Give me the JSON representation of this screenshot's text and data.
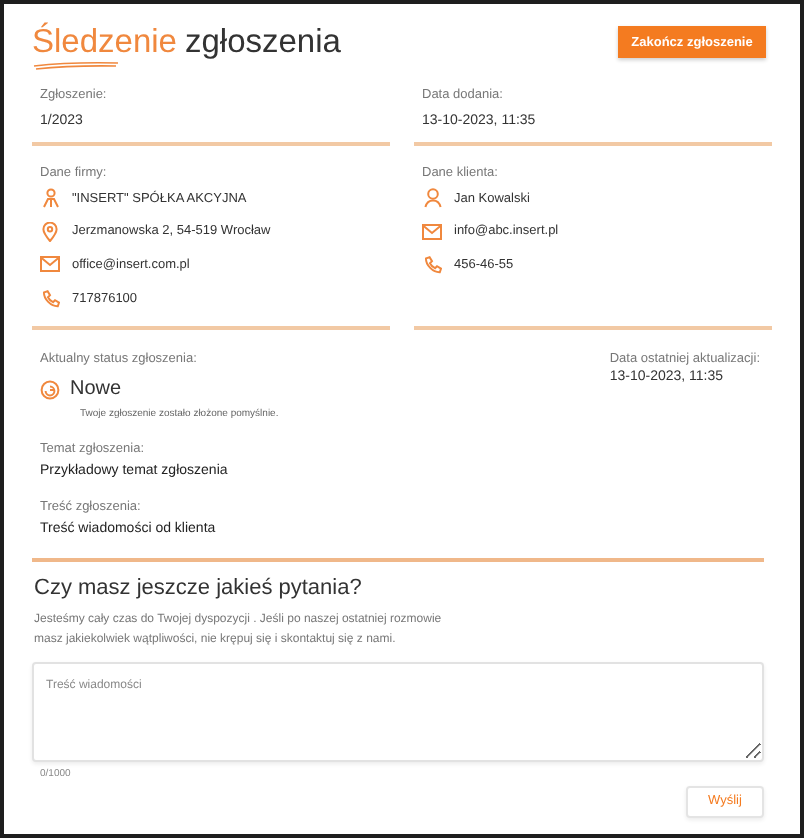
{
  "title": {
    "highlight": "Śledzenie",
    "rest": "zgłoszenia"
  },
  "close_button": "Zakończ zgłoszenie",
  "fields": [
    {
      "label": "Zgłoszenie:",
      "value": "1/2023"
    },
    {
      "label": "Data dodania:",
      "value": "13-10-2023, 11:35"
    }
  ],
  "contacts": [
    {
      "label": "Dane firmy:",
      "items": [
        {
          "kind": "org",
          "text": "\"INSERT\" SPÓŁKA AKCYJNA"
        },
        {
          "kind": "location",
          "text": "Jerzmanowska 2, 54-519 Wrocław"
        },
        {
          "kind": "email",
          "text": "office@insert.com.pl"
        },
        {
          "kind": "phone",
          "text": "717876100"
        }
      ]
    },
    {
      "label": "Dane klienta:",
      "items": [
        {
          "kind": "person",
          "text": "Jan Kowalski"
        },
        {
          "kind": "email",
          "text": "info@abc.insert.pl"
        },
        {
          "kind": "phone",
          "text": "456-46-55"
        }
      ]
    }
  ],
  "status": {
    "label": "Aktualny status zgłoszenia:",
    "value": "Nowe",
    "note": "Twoje zgłoszenie zostało złożone pomyślnie."
  },
  "last_update": {
    "label": "Data ostatniej aktualizacji:",
    "value": "13-10-2023, 11:35"
  },
  "details": [
    {
      "label": "Temat zgłoszenia:",
      "value": "Przykładowy temat zgłoszenia"
    },
    {
      "label": "Treść zgłoszenia:",
      "value": "Treść wiadomości od klienta"
    }
  ],
  "questions": {
    "heading": "Czy masz jeszcze jakieś pytania?",
    "text_lines": [
      "Jesteśmy cały czas do Twojej dyspozycji . Jeśli po naszej ostatniej rozmowie",
      "masz jakiekolwiek wątpliwości, nie krępuj się i skontaktuj się z nami."
    ],
    "message_field": {
      "placeholder": "Treść wiadomości"
    },
    "counter": "0/1000",
    "send_button": "Wyślij"
  }
}
